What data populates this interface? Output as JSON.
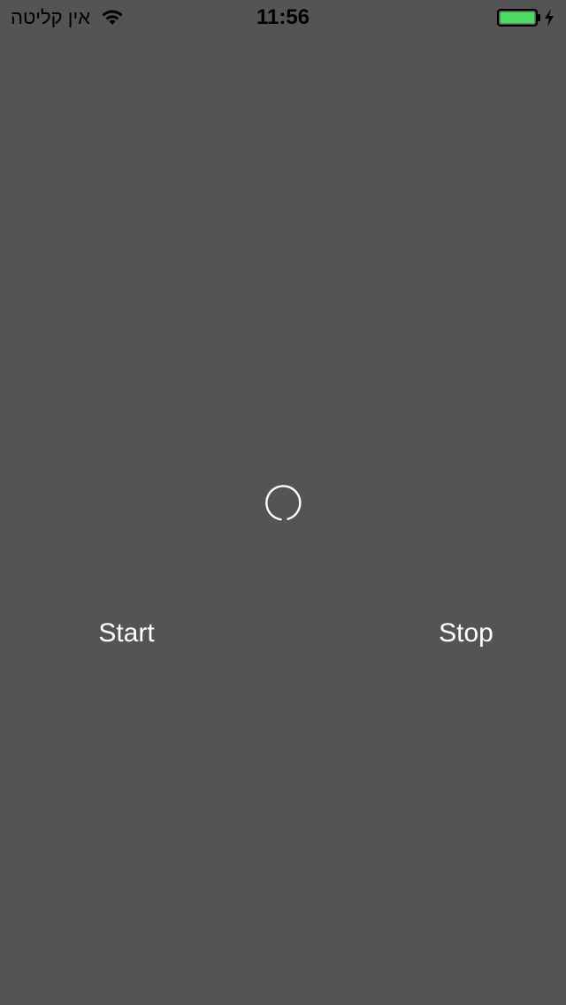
{
  "status_bar": {
    "carrier": "אין קליטה",
    "time": "11:56",
    "battery_color": "#4cd964",
    "text_color": "#000000"
  },
  "main": {
    "background": "#545454",
    "activity_indicator": "spinner-icon",
    "start_label": "Start",
    "stop_label": "Stop"
  }
}
